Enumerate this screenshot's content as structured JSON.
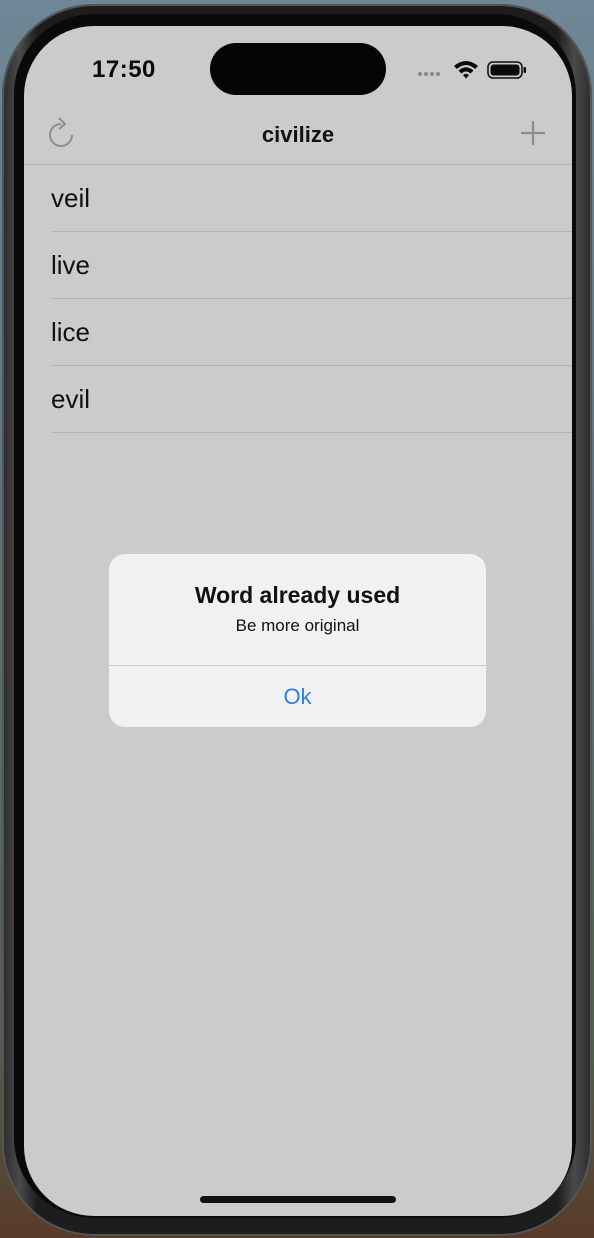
{
  "status_bar": {
    "time": "17:50",
    "icons": [
      "cellular-icon",
      "wifi-icon",
      "battery-icon"
    ]
  },
  "nav": {
    "title": "civilize",
    "left_icon": "refresh-icon",
    "right_icon": "plus-icon"
  },
  "words": [
    "veil",
    "live",
    "lice",
    "evil"
  ],
  "alert": {
    "title": "Word already used",
    "message": "Be more original",
    "button_label": "Ok"
  },
  "colors": {
    "screen_bg": "#cbcbcb",
    "accent": "#2f7de1",
    "alert_bg": "#f2f2f2"
  }
}
